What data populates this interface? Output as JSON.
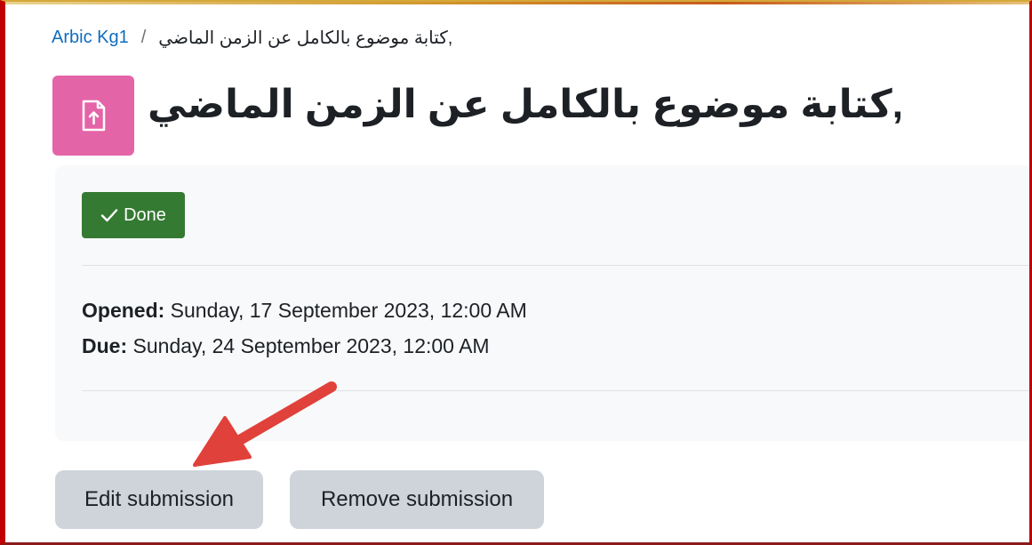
{
  "breadcrumb": {
    "course": "Arbic Kg1",
    "separator": "/",
    "current": "كتابة موضوع بالكامل عن الزمن الماضي,"
  },
  "page": {
    "title": "كتابة موضوع بالكامل عن الزمن الماضي,",
    "icon": "assignment-upload-icon"
  },
  "completion": {
    "label": "Done",
    "icon": "check-icon"
  },
  "dates": {
    "opened_label": "Opened:",
    "opened_value": "Sunday, 17 September 2023, 12:00 AM",
    "due_label": "Due:",
    "due_value": "Sunday, 24 September 2023, 12:00 AM"
  },
  "actions": {
    "edit_label": "Edit submission",
    "remove_label": "Remove submission"
  },
  "colors": {
    "accent": "#0f6cbf",
    "icon_bg": "#e464a8",
    "done_bg": "#357a32",
    "arrow": "#e0413a"
  }
}
